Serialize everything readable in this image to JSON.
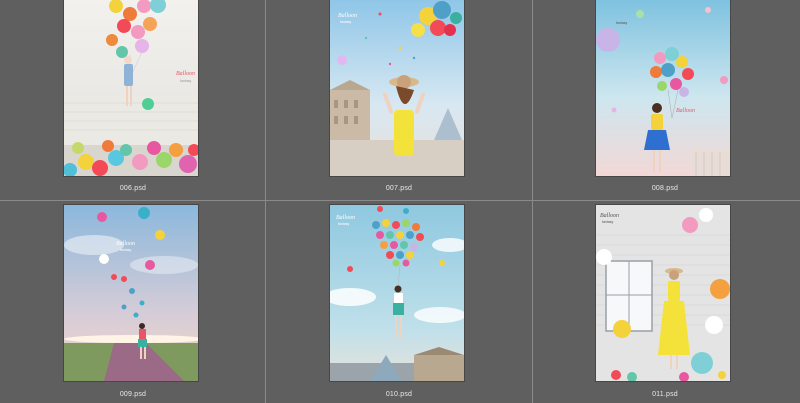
{
  "files": [
    {
      "name": "006.psd",
      "caption": "Balloon",
      "subcaption": "fantasy"
    },
    {
      "name": "007.psd",
      "caption": "Balloon",
      "subcaption": "fantasy"
    },
    {
      "name": "008.psd",
      "caption": "Balloon",
      "subcaption": "fantasy"
    },
    {
      "name": "009.psd",
      "caption": "Balloon",
      "subcaption": "fantasy"
    },
    {
      "name": "010.psd",
      "caption": "Balloon",
      "subcaption": "fantasy"
    },
    {
      "name": "011.psd",
      "caption": "Balloon",
      "subcaption": "fantasy"
    }
  ],
  "colors": {
    "background": "#5f5f5f",
    "divider": "#8a8a8a",
    "label": "#e8e8e8"
  }
}
